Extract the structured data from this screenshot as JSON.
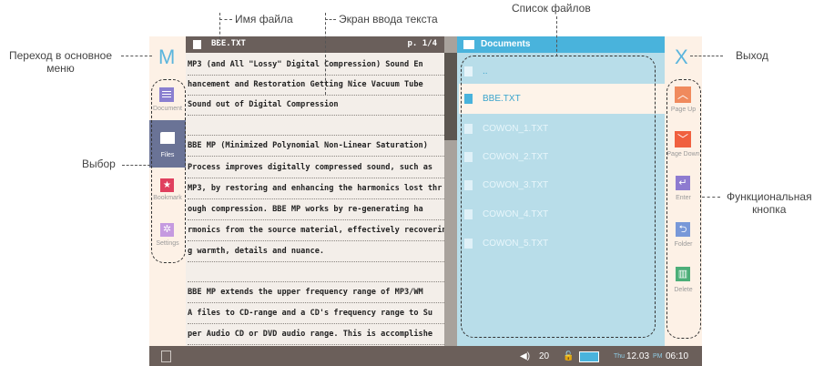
{
  "callouts": {
    "main_menu": "Переход в основное\nменю",
    "file_name": "Имя файла",
    "text_screen": "Экран ввода текста",
    "file_list": "Список файлов",
    "exit": "Выход",
    "select": "Выбор",
    "function_button": "Функциональная\nкнопка"
  },
  "device": {
    "left_logo": "M",
    "exit_glyph": "X",
    "sidebar": [
      {
        "label": "Document",
        "icon": "document-icon"
      },
      {
        "label": "Files",
        "icon": "folder-icon"
      },
      {
        "label": "Bookmark",
        "icon": "bookmark-icon"
      },
      {
        "label": "Settings",
        "icon": "gear-icon"
      }
    ],
    "text_title": "BBE.TXT",
    "page_indicator": "p. 1/4",
    "text_lines": [
      "MP3 (and All \"Lossy\" Digital Compression) Sound En",
      "hancement and Restoration Getting Nice Vacuum Tube",
      "Sound out of Digital Compression",
      "",
      "BBE MP (Minimized Polynomial Non-Linear Saturation)",
      "Process improves digitally compressed sound, such as",
      "MP3, by restoring and enhancing the harmonics lost thr",
      "ough compression. BBE MP works by re-generating ha",
      "rmonics from the source material, effectively recoverin",
      "g warmth, details and nuance.",
      "",
      "BBE MP extends the upper frequency range of MP3/WM",
      "A files to CD-range and a CD's frequency range to Su",
      "per Audio CD or DVD audio range. This is accomplishe"
    ],
    "list_title": "Documents",
    "files": [
      "..",
      "BBE.TXT",
      "COWON_1.TXT",
      "COWON_2.TXT",
      "COWON_3.TXT",
      "COWON_4.TXT",
      "COWON_5.TXT"
    ],
    "buttons": [
      {
        "label": "Page Up",
        "icon": "chevron-up-icon",
        "color": "#f08a5d"
      },
      {
        "label": "Page Down",
        "icon": "chevron-down-icon",
        "color": "#f0603f"
      },
      {
        "label": "Enter",
        "icon": "enter-icon",
        "color": "#8e7bd0"
      },
      {
        "label": "Folder",
        "icon": "back-icon",
        "color": "#7898d8"
      },
      {
        "label": "Delete",
        "icon": "trash-icon",
        "color": "#4cae78"
      }
    ],
    "status": {
      "volume": "20",
      "day": "Thu",
      "date": "12.03",
      "ampm": "PM",
      "time": "06:10"
    }
  }
}
